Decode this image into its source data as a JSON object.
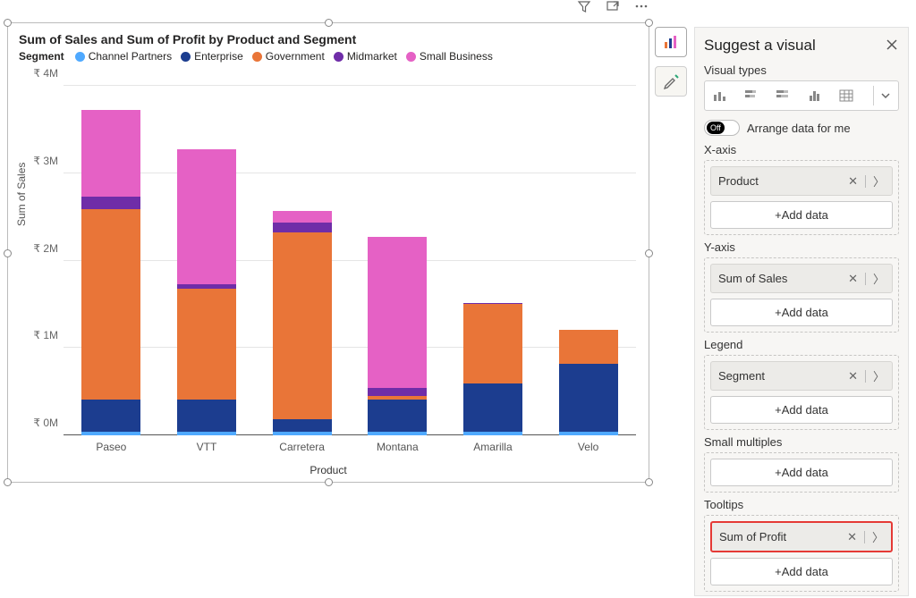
{
  "chart_title": "Sum of Sales and Sum of Profit by Product and Segment",
  "legend_label": "Segment",
  "series": [
    {
      "name": "Channel Partners",
      "color": "#4fa9ff"
    },
    {
      "name": "Enterprise",
      "color": "#1c3d8f"
    },
    {
      "name": "Government",
      "color": "#e97538"
    },
    {
      "name": "Midmarket",
      "color": "#6f2da8"
    },
    {
      "name": "Small Business",
      "color": "#e561c5"
    }
  ],
  "y_axis_title": "Sum of Sales",
  "x_axis_title": "Product",
  "y_ticks": [
    "₹ 0M",
    "₹ 1M",
    "₹ 2M",
    "₹ 3M",
    "₹ 4M"
  ],
  "categories": [
    "Paseo",
    "VTT",
    "Carretera",
    "Montana",
    "Amarilla",
    "Velo"
  ],
  "chart_data": {
    "type": "bar",
    "stacked": true,
    "title": "Sum of Sales and Sum of Profit by Product and Segment",
    "xlabel": "Product",
    "ylabel": "Sum of Sales",
    "y_unit": "₹M",
    "ylim": [
      0,
      4.4
    ],
    "legend_title": "Segment",
    "categories": [
      "Paseo",
      "VTT",
      "Carretera",
      "Montana",
      "Amarilla",
      "Velo"
    ],
    "series": [
      {
        "name": "Channel Partners",
        "values": [
          0.05,
          0.05,
          0.05,
          0.05,
          0.05,
          0.05
        ]
      },
      {
        "name": "Enterprise",
        "values": [
          0.4,
          0.4,
          0.15,
          0.4,
          0.6,
          0.85
        ]
      },
      {
        "name": "Government",
        "values": [
          2.4,
          1.4,
          2.35,
          0.05,
          1.0,
          0.43
        ]
      },
      {
        "name": "Midmarket",
        "values": [
          0.15,
          0.05,
          0.13,
          0.1,
          0.02,
          0.0
        ]
      },
      {
        "name": "Small Business",
        "values": [
          1.1,
          1.7,
          0.15,
          1.9,
          0.0,
          0.0
        ]
      }
    ],
    "totals": [
      4.1,
      3.6,
      2.83,
      2.5,
      1.67,
      1.33
    ]
  },
  "top_icons": {
    "filter": "Filter",
    "focus": "Focus",
    "more": "More options"
  },
  "pane": {
    "title": "Suggest a visual",
    "close": "Close",
    "visual_types_label": "Visual types",
    "arrange_toggle_text": "Off",
    "arrange_label": "Arrange data for me",
    "fields": [
      {
        "label": "X-axis",
        "items": [
          {
            "type": "pill",
            "text": "Product"
          },
          {
            "type": "add",
            "text": "+Add data"
          }
        ]
      },
      {
        "label": "Y-axis",
        "items": [
          {
            "type": "pill",
            "text": "Sum of Sales"
          },
          {
            "type": "add",
            "text": "+Add data"
          }
        ]
      },
      {
        "label": "Legend",
        "items": [
          {
            "type": "pill",
            "text": "Segment"
          },
          {
            "type": "add",
            "text": "+Add data"
          }
        ]
      },
      {
        "label": "Small multiples",
        "items": [
          {
            "type": "add",
            "text": "+Add data"
          }
        ]
      },
      {
        "label": "Tooltips",
        "items": [
          {
            "type": "pill",
            "text": "Sum of Profit",
            "highlight": true
          },
          {
            "type": "add",
            "text": "+Add data"
          }
        ]
      }
    ]
  }
}
